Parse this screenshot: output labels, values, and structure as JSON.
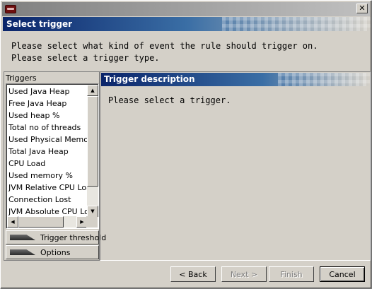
{
  "banner": {
    "title": "Select trigger"
  },
  "instructions": {
    "line1": "Please select what kind of event the rule should trigger on.",
    "line2": "Please select a trigger type."
  },
  "triggers": {
    "label": "Triggers",
    "items": [
      "Used Java Heap",
      "Free Java Heap",
      "Used heap %",
      "Total no of threads",
      "Used Physical Memory",
      "Total Java Heap",
      "CPU Load",
      "Used memory %",
      "JVM Relative CPU Load",
      "Connection Lost",
      "JVM Absolute CPU Load"
    ]
  },
  "sections": {
    "threshold_label": "Trigger threshold",
    "options_label": "Options"
  },
  "description": {
    "header": "Trigger description",
    "text": "Please select a trigger."
  },
  "buttons": {
    "back": "< Back",
    "next": "Next >",
    "finish": "Finish",
    "cancel": "Cancel"
  },
  "colors": {
    "accent": "#0a246a",
    "face": "#d4d0c8"
  },
  "icons": {
    "close": "close-icon",
    "app": "app-icon"
  }
}
